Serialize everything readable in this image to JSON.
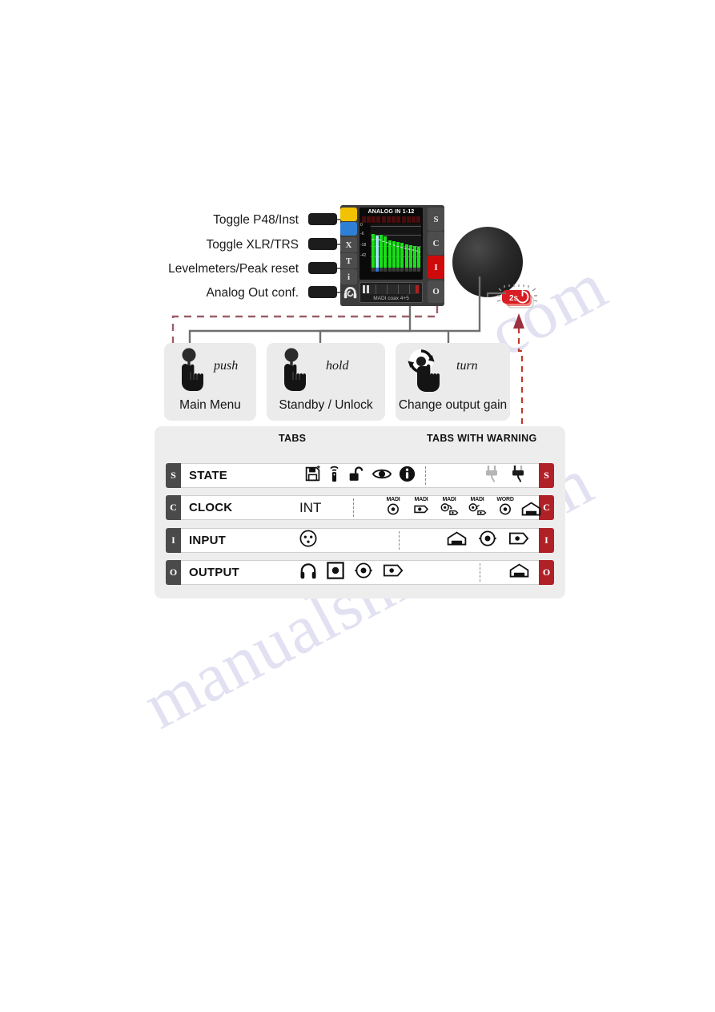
{
  "watermark": {
    "line1": "manualshive.com",
    "line2": "e.com"
  },
  "left_labels": [
    {
      "text": "Toggle P48/Inst",
      "name": "label-toggle-p48-inst"
    },
    {
      "text": "Toggle XLR/TRS",
      "name": "label-toggle-xlr-trs"
    },
    {
      "text": "Levelmeters/Peak reset",
      "name": "label-levelmeters-peak-reset"
    },
    {
      "text": "Analog Out conf.",
      "name": "label-analog-out-conf"
    }
  ],
  "device": {
    "screen_title": "ANALOG IN 1-12",
    "scale_labels": [
      "0",
      "-6",
      "-18",
      "-42"
    ],
    "output_label": "MADI coax 4+5",
    "left_buttons": [
      "X",
      "T",
      "i"
    ],
    "right_buttons": [
      "S",
      "C",
      "I",
      "O"
    ],
    "active_right_button": "I",
    "colors": {
      "yellow_button": "#f2c200",
      "blue_button": "#2f7fd6",
      "active_red": "#cf0a0a",
      "meter_green": "#18e018",
      "meter_cyan": "#9fe8f0"
    }
  },
  "power_badge": {
    "text": "2s",
    "icon": "power-icon",
    "color": "#d81e24"
  },
  "gestures": [
    {
      "word": "push",
      "caption": "Main Menu",
      "icon": "hand-push-icon"
    },
    {
      "word": "hold",
      "caption": "Standby / Unlock",
      "icon": "hand-hold-icon"
    },
    {
      "word": "turn",
      "caption": "Change output gain",
      "icon": "hand-turn-icon"
    }
  ],
  "panel": {
    "headers": {
      "tabs": "TABS",
      "tabs_with_warning": "TABS WITH WARNING"
    },
    "rows": [
      {
        "badge": "S",
        "name": "STATE",
        "value": "",
        "icons": [
          "floppy-save-icon",
          "remote-control-icon",
          "unlocked-padlock-icon",
          "eye-icon",
          "info-icon"
        ],
        "warning_icons": [
          "power-plug-grey-icon",
          "power-plug-dark-icon"
        ]
      },
      {
        "badge": "C",
        "name": "CLOCK",
        "value": "INT",
        "icons": [],
        "warning_icons": [
          "madi-coax-icon",
          "madi-optical-icon",
          "madi-coax-to-opt-icon",
          "madi-opt-to-coax-icon",
          "word-clock-icon",
          "ethernet-jack-icon"
        ],
        "warning_captions": [
          "MADI",
          "MADI",
          "MADI",
          "MADI",
          "WORD",
          ""
        ]
      },
      {
        "badge": "I",
        "name": "INPUT",
        "value": "",
        "icons": [
          "xlr-connector-icon"
        ],
        "warning_icons": [
          "ethernet-jack-icon",
          "coax-bnc-icon",
          "optical-icon"
        ]
      },
      {
        "badge": "O",
        "name": "OUTPUT",
        "value": "",
        "icons": [
          "headphones-icon",
          "square-dot-icon",
          "coax-bnc-icon",
          "optical-icon"
        ],
        "warning_icons": [
          "ethernet-jack-icon"
        ]
      }
    ],
    "colors": {
      "badge_left": "#4a4a4a",
      "badge_right": "#b02027"
    }
  }
}
